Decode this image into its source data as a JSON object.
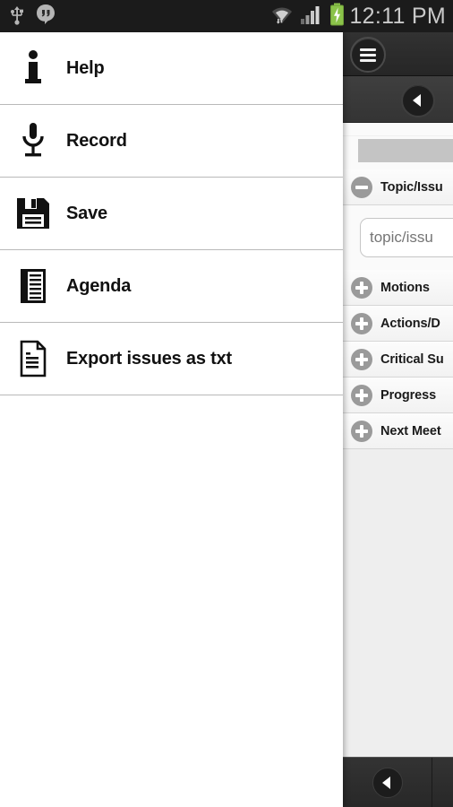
{
  "status_bar": {
    "icons_left": [
      "usb-icon",
      "hangouts-icon"
    ],
    "icons_right": [
      "wifi-icon",
      "cellular-signal-icon",
      "battery-charging-icon"
    ],
    "time": "12:11 PM"
  },
  "drawer": {
    "items": [
      {
        "label": "Help",
        "icon": "info-icon"
      },
      {
        "label": "Record",
        "icon": "microphone-icon"
      },
      {
        "label": "Save",
        "icon": "floppy-disk-icon"
      },
      {
        "label": "Agenda",
        "icon": "agenda-list-icon"
      },
      {
        "label": "Export issues as txt",
        "icon": "text-document-icon"
      }
    ]
  },
  "app": {
    "action_bar": {
      "menu_button": "menu-icon"
    },
    "sub_bar": {
      "back_button": "chevron-left-icon"
    },
    "sections": [
      {
        "label": "Topic/Issu",
        "state": "expanded",
        "icon": "minus-circle-icon"
      },
      {
        "label": "Motions",
        "state": "collapsed",
        "icon": "plus-circle-icon"
      },
      {
        "label": "Actions/D",
        "state": "collapsed",
        "icon": "plus-circle-icon"
      },
      {
        "label": "Critical Su",
        "state": "collapsed",
        "icon": "plus-circle-icon"
      },
      {
        "label": "Progress",
        "state": "collapsed",
        "icon": "plus-circle-icon"
      },
      {
        "label": "Next Meet",
        "state": "collapsed",
        "icon": "plus-circle-icon"
      }
    ],
    "topic_input": {
      "value": "",
      "placeholder": "topic/issu"
    },
    "nav_bar": {
      "back_button": "chevron-left-icon"
    }
  },
  "colors": {
    "status_bar_bg": "#1b1b1b",
    "action_bar_bg": "#2c2c2c",
    "sub_bar_bg": "#3a3a3a",
    "drawer_bg": "#ffffff",
    "panel_bg": "#eeeeee",
    "battery_green": "#8bc34a",
    "toggle_gray": "#9a9a9a"
  }
}
